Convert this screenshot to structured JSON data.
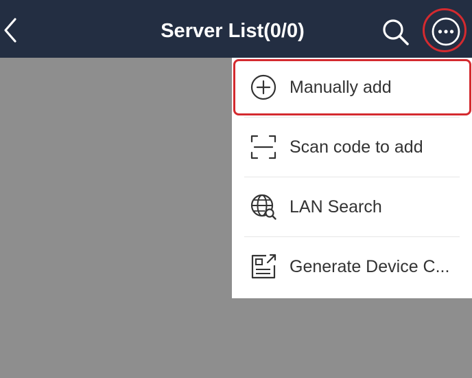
{
  "header": {
    "title": "Server List(0/0)",
    "back_icon": "chevron-left-icon",
    "search_icon": "search-icon",
    "more_icon": "more-horizontal-icon"
  },
  "menu": {
    "items": [
      {
        "label": "Manually add",
        "icon": "plus-circle-icon"
      },
      {
        "label": "Scan code to add",
        "icon": "scan-icon"
      },
      {
        "label": "LAN Search",
        "icon": "globe-search-icon"
      },
      {
        "label": "Generate Device C...",
        "icon": "device-code-icon"
      }
    ]
  },
  "colors": {
    "header_bg": "#232e42",
    "overlay_bg": "#8e8e8e",
    "highlight": "#d42a2f",
    "menu_text": "#333333"
  }
}
